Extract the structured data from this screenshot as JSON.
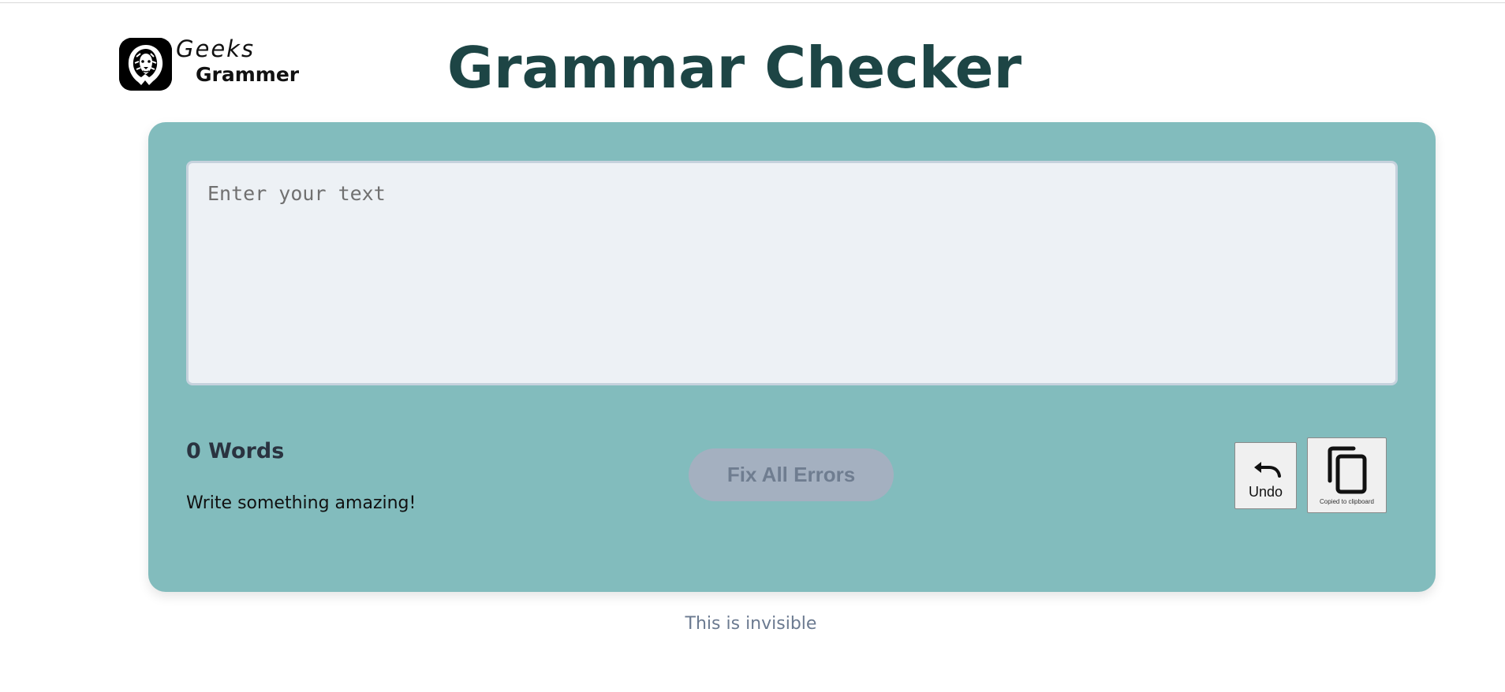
{
  "brand": {
    "line1": "Geeks",
    "line2": "Grammer",
    "logo_icon": "lion-icon"
  },
  "header": {
    "title": "Grammar Checker"
  },
  "editor": {
    "placeholder": "Enter your text",
    "value": ""
  },
  "stats": {
    "word_count_label": "0 Words",
    "hint": "Write something amazing!"
  },
  "actions": {
    "fix_all_label": "Fix All Errors",
    "fix_all_disabled": true,
    "undo_label": "Undo",
    "undo_icon": "undo-arrow-icon",
    "copy_label": "Copied to clipboard",
    "copy_icon": "copy-icon"
  },
  "footer": {
    "note": "This is invisible"
  },
  "colors": {
    "title": "#1d4545",
    "card_bg": "#82bcbd",
    "editor_bg": "#edf1f5",
    "button_disabled_bg": "#a4b0c0",
    "footer_text": "#6b7a90"
  }
}
